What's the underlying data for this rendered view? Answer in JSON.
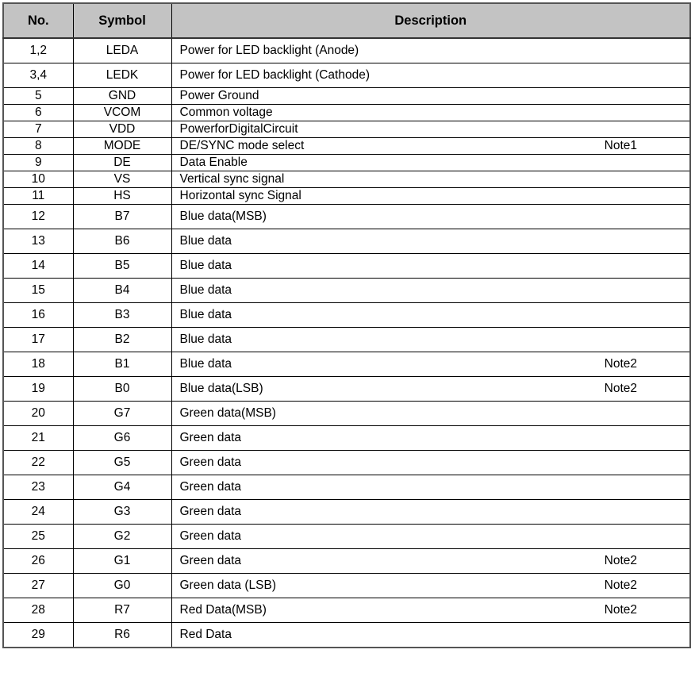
{
  "document": {
    "kind": "datasheet-pin-assignment-table",
    "accent_header_bg": "#c3c3c3",
    "border_color": "#000000",
    "text_color": "#000000"
  },
  "table": {
    "columns": [
      {
        "key": "no",
        "label": "No."
      },
      {
        "key": "symbol",
        "label": "Symbol"
      },
      {
        "key": "description",
        "label": "Description"
      }
    ],
    "rows": [
      {
        "no": "1,2",
        "symbol": "LEDA",
        "description": "Power for LED backlight (Anode)",
        "note": "",
        "compact": false
      },
      {
        "no": "3,4",
        "symbol": "LEDK",
        "description": "Power for LED backlight (Cathode)",
        "note": "",
        "compact": false
      },
      {
        "no": "5",
        "symbol": "GND",
        "description": "Power Ground",
        "note": "",
        "compact": true
      },
      {
        "no": "6",
        "symbol": "VCOM",
        "description": "Common voltage",
        "note": "",
        "compact": true
      },
      {
        "no": "7",
        "symbol": "VDD",
        "description": "PowerforDigitalCircuit",
        "note": "",
        "compact": true
      },
      {
        "no": "8",
        "symbol": "MODE",
        "description": "DE/SYNC mode select",
        "note": "Note1",
        "compact": true
      },
      {
        "no": "9",
        "symbol": "DE",
        "description": "Data Enable",
        "note": "",
        "compact": true
      },
      {
        "no": "10",
        "symbol": "VS",
        "description": "Vertical sync signal",
        "note": "",
        "compact": true
      },
      {
        "no": "11",
        "symbol": "HS",
        "description": "Horizontal sync Signal",
        "note": "",
        "compact": true
      },
      {
        "no": "12",
        "symbol": "B7",
        "description": "Blue data(MSB)",
        "note": "",
        "compact": false
      },
      {
        "no": "13",
        "symbol": "B6",
        "description": "Blue data",
        "note": "",
        "compact": false
      },
      {
        "no": "14",
        "symbol": "B5",
        "description": "Blue data",
        "note": "",
        "compact": false
      },
      {
        "no": "15",
        "symbol": "B4",
        "description": "Blue data",
        "note": "",
        "compact": false
      },
      {
        "no": "16",
        "symbol": "B3",
        "description": "Blue data",
        "note": "",
        "compact": false
      },
      {
        "no": "17",
        "symbol": "B2",
        "description": "Blue data",
        "note": "",
        "compact": false
      },
      {
        "no": "18",
        "symbol": "B1",
        "description": "Blue data",
        "note": "Note2",
        "compact": false
      },
      {
        "no": "19",
        "symbol": "B0",
        "description": "Blue data(LSB)",
        "note": "Note2",
        "compact": false
      },
      {
        "no": "20",
        "symbol": "G7",
        "description": "Green data(MSB)",
        "note": "",
        "compact": false
      },
      {
        "no": "21",
        "symbol": "G6",
        "description": "Green data",
        "note": "",
        "compact": false
      },
      {
        "no": "22",
        "symbol": "G5",
        "description": "Green data",
        "note": "",
        "compact": false
      },
      {
        "no": "23",
        "symbol": "G4",
        "description": "Green data",
        "note": "",
        "compact": false
      },
      {
        "no": "24",
        "symbol": "G3",
        "description": "Green data",
        "note": "",
        "compact": false
      },
      {
        "no": "25",
        "symbol": "G2",
        "description": "Green data",
        "note": "",
        "compact": false
      },
      {
        "no": "26",
        "symbol": "G1",
        "description": "Green data",
        "note": "Note2",
        "compact": false
      },
      {
        "no": "27",
        "symbol": "G0",
        "description": "Green data (LSB)",
        "note": "Note2",
        "compact": false
      },
      {
        "no": "28",
        "symbol": "R7",
        "description": "Red Data(MSB)",
        "note": "Note2",
        "compact": false
      },
      {
        "no": "29",
        "symbol": "R6",
        "description": "Red Data",
        "note": "",
        "compact": false
      }
    ]
  }
}
